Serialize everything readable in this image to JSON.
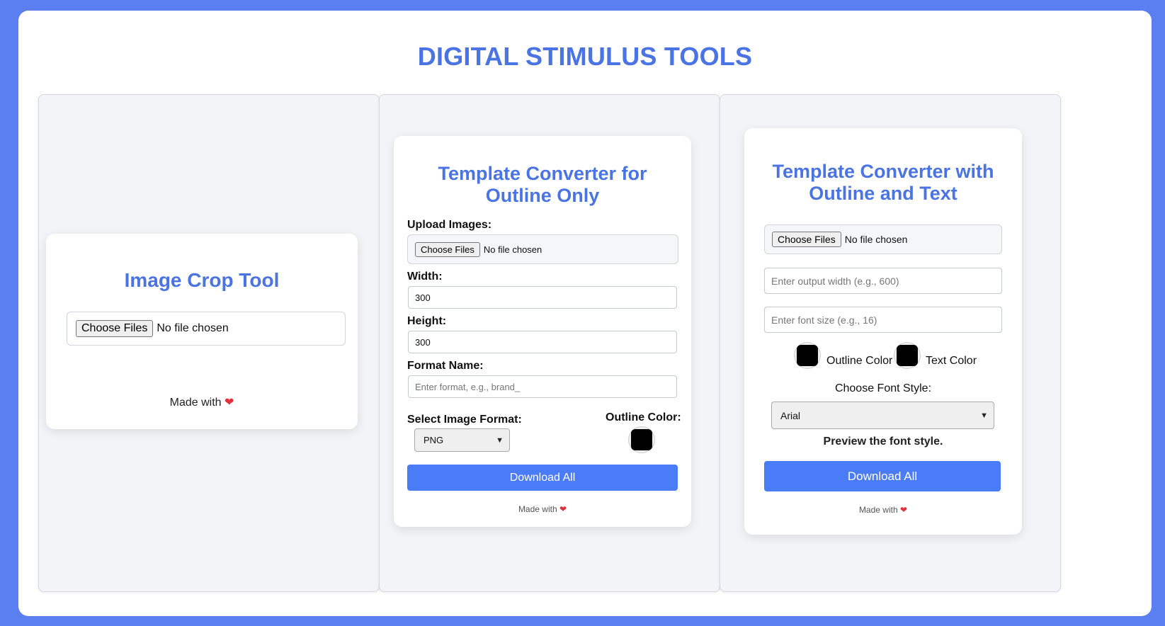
{
  "page": {
    "title": "DIGITAL STIMULUS TOOLS"
  },
  "crop_tool": {
    "title": "Image Crop Tool",
    "choose_label": "Choose Files",
    "file_status": "No file chosen",
    "made_with": "Made with"
  },
  "outline_tool": {
    "title_line1": "Template Converter for",
    "title_line2": "Outline Only",
    "upload_label": "Upload Images:",
    "choose_label": "Choose Files",
    "file_status": "No file chosen",
    "width_label": "Width:",
    "width_value": "300",
    "height_label": "Height:",
    "height_value": "300",
    "format_name_label": "Format Name:",
    "format_name_placeholder": "Enter format, e.g., brand_",
    "image_format_label": "Select Image Format:",
    "image_format_selected": "PNG",
    "outline_color_label": "Outline Color:",
    "outline_color": "#000000",
    "download_label": "Download All",
    "made_with": "Made with"
  },
  "text_tool": {
    "title_line1": "Template Converter with",
    "title_line2": "Outline and Text",
    "choose_label": "Choose Files",
    "file_status": "No file chosen",
    "width_placeholder": "Enter output width (e.g., 600)",
    "font_size_placeholder": "Enter font size (e.g., 16)",
    "outline_color_label": "Outline Color",
    "outline_color": "#000000",
    "text_color_label": "Text Color",
    "text_color": "#000000",
    "font_style_label": "Choose Font Style:",
    "font_style_selected": "Arial",
    "preview_text": "Preview the font style.",
    "download_label": "Download All",
    "made_with": "Made with"
  },
  "colors": {
    "accent": "#4a74e4",
    "button": "#4a7cf7",
    "background": "#5b7ff0"
  },
  "icons": {
    "heart": "heart-icon"
  }
}
